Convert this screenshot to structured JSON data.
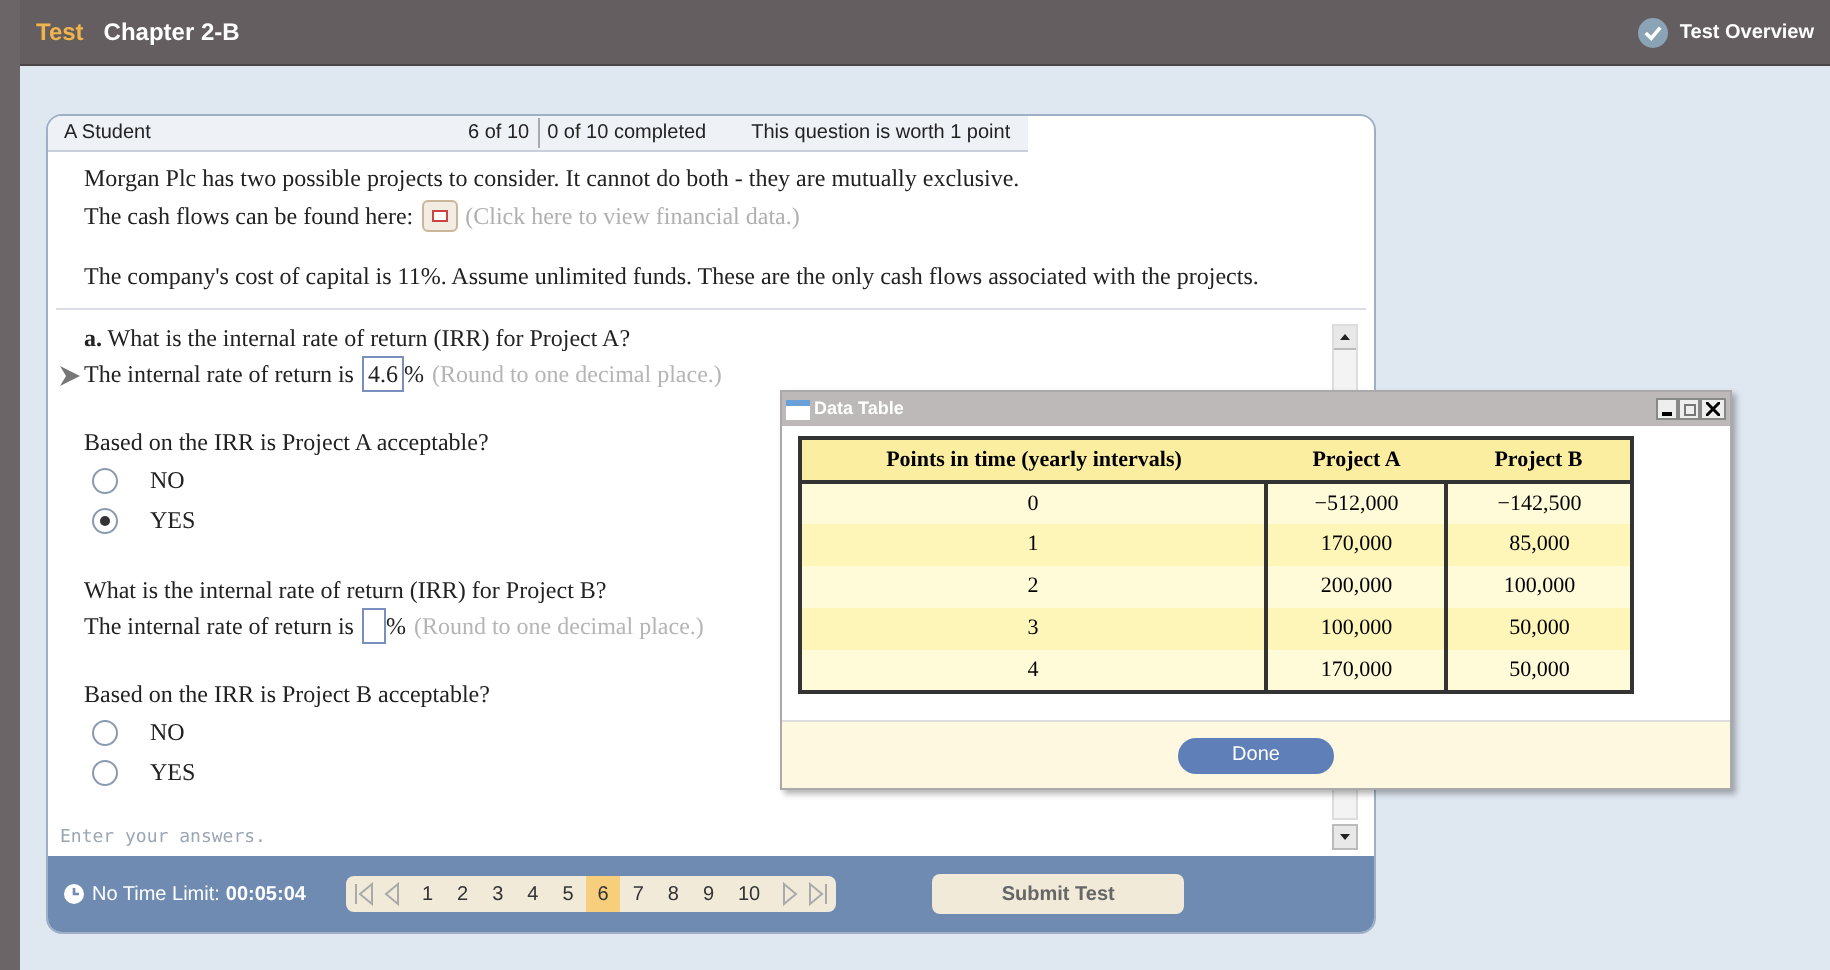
{
  "header": {
    "label": "Test",
    "title": "Chapter 2-B",
    "overview": "Test Overview"
  },
  "info": {
    "student": "A Student",
    "position": "6 of 10",
    "completed": "0 of 10 completed",
    "worth": "This question is worth 1 point"
  },
  "intro": [
    "Morgan Plc has two possible projects to consider. It cannot do both - they are mutually exclusive."
  ],
  "cash_flows": {
    "text": "The cash flows can be found here:",
    "link": "(Click here to view financial data.)"
  },
  "cost": "The company's cost of capital is 11%. Assume unlimited funds. These are the only cash flows associated with the projects.",
  "parts": [
    {
      "kind": "input",
      "question": "**a.** What is the internal rate of return (IRR) for Project A?",
      "prompt": "The internal rate of return is",
      "value": "4.6",
      "unit": "%",
      "hint": "(Round to one decimal place.)",
      "current": true
    },
    {
      "kind": "radio",
      "question": "Based on the IRR is Project A acceptable?",
      "options": [
        {
          "label": "NO",
          "selected": false
        },
        {
          "label": "YES",
          "selected": true
        }
      ]
    },
    {
      "kind": "input",
      "question": "What is the internal rate of return (IRR) for Project B?",
      "prompt": "The internal rate of return is",
      "unit": "%",
      "hint": "(Round to one decimal place.)",
      "current": false
    },
    {
      "kind": "radio",
      "question": "Based on the IRR is Project B acceptable?",
      "options": [
        {
          "label": "NO",
          "selected": false
        },
        {
          "label": "YES",
          "selected": false
        }
      ]
    }
  ],
  "status": "Enter your answers.",
  "footer": {
    "time_label": "No Time Limit:",
    "time": "00:05:04",
    "pages": [
      {
        "label": "1",
        "selected": false
      },
      {
        "label": "2",
        "selected": false
      },
      {
        "label": "3",
        "selected": false
      },
      {
        "label": "4",
        "selected": false
      },
      {
        "label": "5",
        "selected": false
      },
      {
        "label": "6",
        "selected": true
      },
      {
        "label": "7",
        "selected": false
      },
      {
        "label": "8",
        "selected": false
      },
      {
        "label": "9",
        "selected": false
      },
      {
        "label": "10",
        "selected": false
      }
    ],
    "submit": "Submit Test"
  },
  "dialog": {
    "title": "Data Table",
    "columns": [
      "Points in time (yearly intervals)",
      "Project A",
      "Project B"
    ],
    "rows": [
      [
        "0",
        "−512,000",
        "−142,500"
      ],
      [
        "1",
        "170,000",
        "85,000"
      ],
      [
        "2",
        "200,000",
        "100,000"
      ],
      [
        "3",
        "100,000",
        "50,000"
      ],
      [
        "4",
        "170,000",
        "50,000"
      ]
    ],
    "button": "Done"
  }
}
